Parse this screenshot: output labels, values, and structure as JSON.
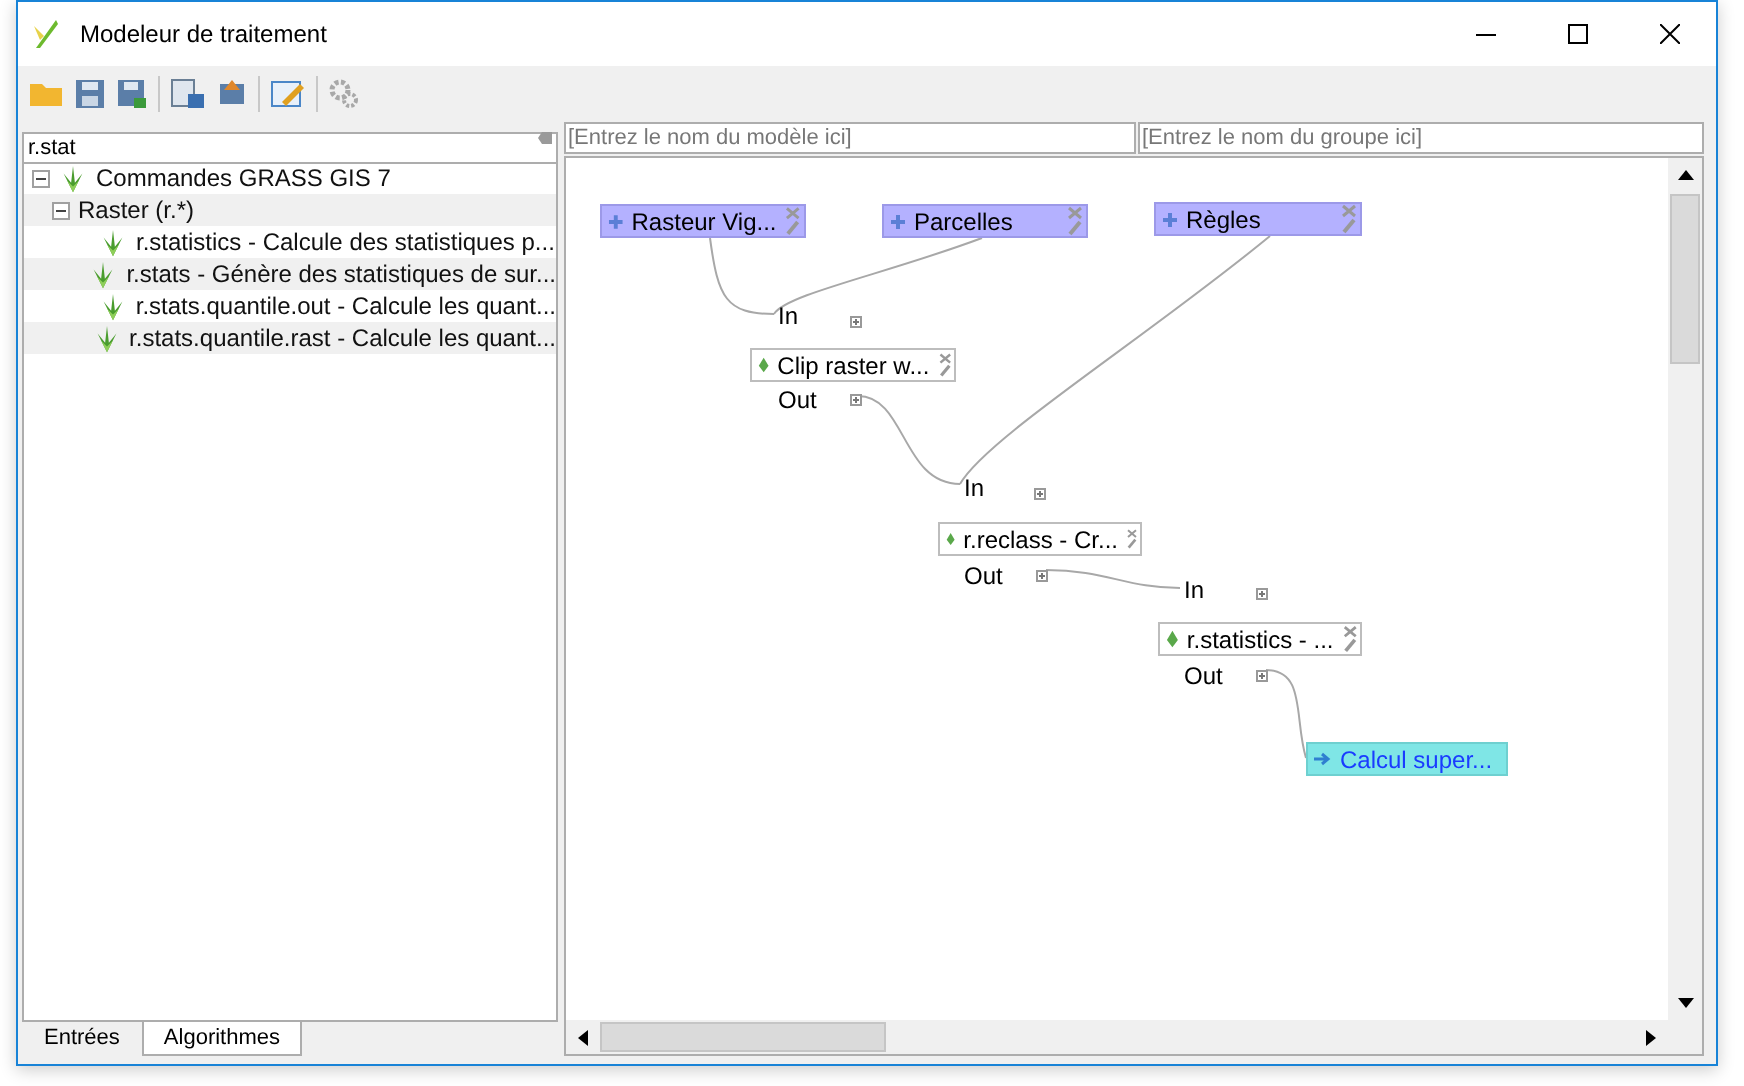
{
  "window": {
    "title": "Modeleur de traitement"
  },
  "search": {
    "value": "r.stat"
  },
  "tree": [
    {
      "label": "Commandes GRASS GIS 7",
      "expanded": true,
      "children": [
        {
          "label": "Raster (r.*)",
          "expanded": true,
          "children": [
            {
              "label": "r.statistics - Calcule des statistiques p..."
            },
            {
              "label": "r.stats - Génère des statistiques de sur..."
            },
            {
              "label": "r.stats.quantile.out - Calcule les quant..."
            },
            {
              "label": "r.stats.quantile.rast - Calcule les quant..."
            }
          ]
        }
      ]
    }
  ],
  "tabs": [
    {
      "label": "Entrées",
      "selected": false
    },
    {
      "label": "Algorithmes",
      "selected": true
    }
  ],
  "model_name": {
    "placeholder": "[Entrez le nom du modèle ici]"
  },
  "group_name": {
    "placeholder": "[Entrez le nom du groupe ici]"
  },
  "canvas": {
    "nodes": [
      {
        "kind": "input",
        "label": "Rasteur Vig..."
      },
      {
        "kind": "input",
        "label": "Parcelles"
      },
      {
        "kind": "input",
        "label": "Règles"
      },
      {
        "kind": "algorithm",
        "label": "Clip raster w..."
      },
      {
        "kind": "algorithm",
        "label": "r.reclass - Cr..."
      },
      {
        "kind": "algorithm",
        "label": "r.statistics - ..."
      },
      {
        "kind": "output",
        "label": "Calcul super..."
      }
    ],
    "ports": [
      {
        "label": "In"
      },
      {
        "label": "Out"
      },
      {
        "label": "In"
      },
      {
        "label": "Out"
      },
      {
        "label": "In"
      },
      {
        "label": "Out"
      }
    ]
  }
}
